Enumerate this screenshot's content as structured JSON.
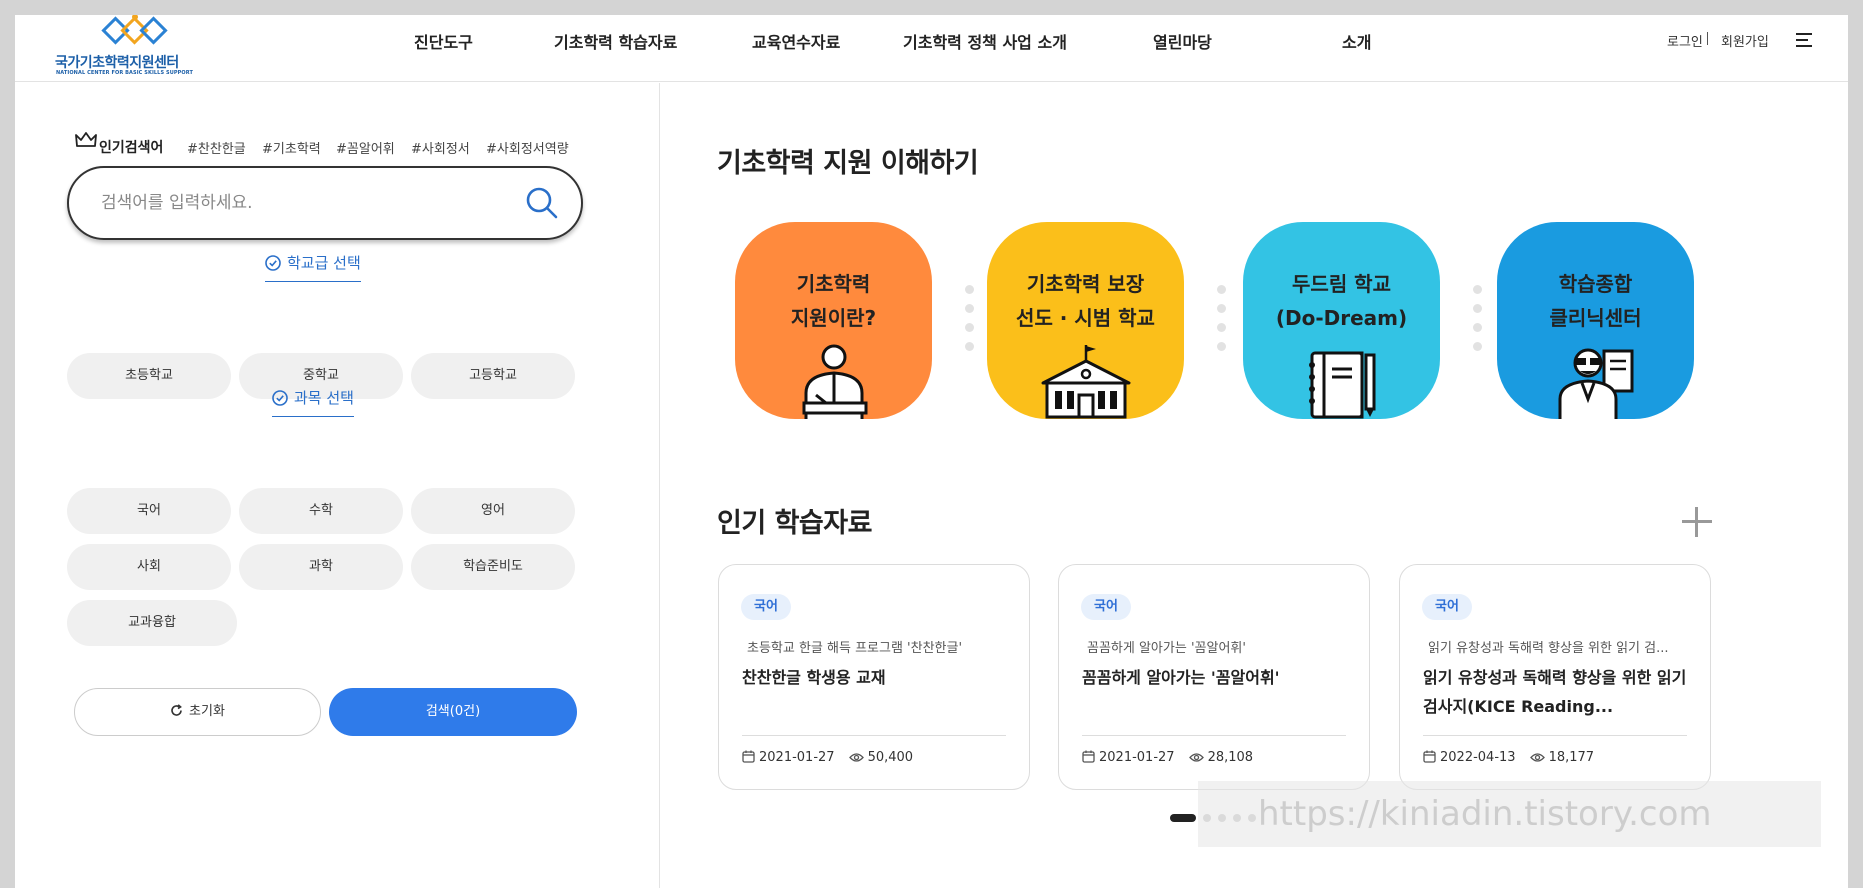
{
  "logo": {
    "name": "국가기초학력지원센터",
    "sub": "NATIONAL CENTER FOR BASIC SKILLS SUPPORT"
  },
  "nav": [
    {
      "label": "진단도구"
    },
    {
      "label": "기초학력 학습자료"
    },
    {
      "label": "교육연수자료"
    },
    {
      "label": "기초학력 정책 사업 소개"
    },
    {
      "label": "열린마당"
    },
    {
      "label": "소개"
    }
  ],
  "util": {
    "login": "로그인",
    "join": "회원가입"
  },
  "popular": {
    "label": "인기검색어",
    "tags": [
      "#찬찬한글",
      "#기초학력",
      "#꼼알어휘",
      "#사회정서",
      "#사회정서역량"
    ]
  },
  "search": {
    "placeholder": "검색어를 입력하세요.",
    "value": ""
  },
  "school_level": {
    "title": "학교급 선택",
    "options": [
      "초등학교",
      "중학교",
      "고등학교"
    ]
  },
  "subject": {
    "title": "과목 선택",
    "options": [
      "국어",
      "수학",
      "영어",
      "사회",
      "과학",
      "학습준비도",
      "교과융합"
    ]
  },
  "buttons": {
    "reset": "초기화",
    "search": "검색(0건)"
  },
  "understand": {
    "title": "기초학력 지원 이해하기",
    "items": [
      {
        "line1": "기초학력",
        "line2": "지원이란?",
        "color": "#ff8a3d"
      },
      {
        "line1": "기초학력 보장",
        "line2": "선도 · 시범 학교",
        "color": "#fbbf1a"
      },
      {
        "line1": "두드림 학교",
        "line2": "(Do-Dream)",
        "color": "#33c3e4"
      },
      {
        "line1": "학습종합",
        "line2": "클리닉센터",
        "color": "#1a9be0"
      }
    ]
  },
  "popular_materials": {
    "title": "인기 학습자료",
    "cards": [
      {
        "badge": "국어",
        "sub": "초등학교 한글 해득 프로그램 '찬찬한글'",
        "title": "찬찬한글 학생용 교재",
        "date": "2021-01-27",
        "views": "50,400"
      },
      {
        "badge": "국어",
        "sub": "꼼꼼하게 알아가는 '꼼알어휘'",
        "title": "꼼꼼하게 알아가는 '꼼알어휘'",
        "date": "2021-01-27",
        "views": "28,108"
      },
      {
        "badge": "국어",
        "sub": "읽기 유창성과 독해력 향상을 위한 읽기 검...",
        "title": "읽기 유창성과 독해력 향상을 위한 읽기 검사지(KICE Reading...",
        "date": "2022-04-13",
        "views": "18,177"
      }
    ]
  },
  "carousel": {
    "pages": 5,
    "active": 1
  },
  "watermark": "https://kiniadin.tistory.com"
}
